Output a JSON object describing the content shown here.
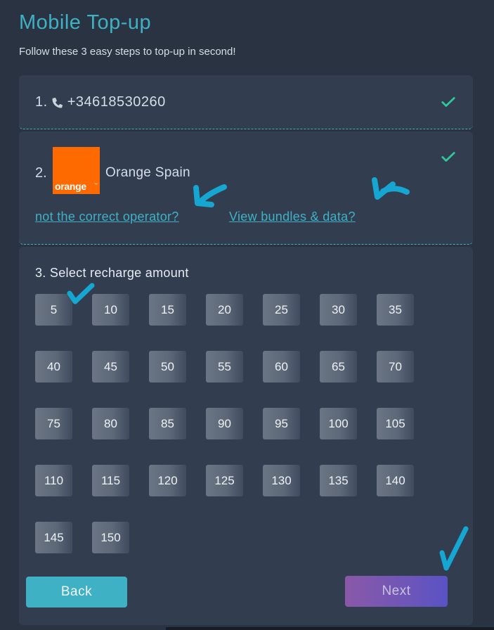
{
  "header": {
    "title": "Mobile Top-up",
    "subtitle": "Follow these 3 easy steps to top-up in second!"
  },
  "step1": {
    "number": "1.",
    "phone_icon": "phone-icon",
    "phone_number": "+34618530260",
    "status_icon": "check-icon"
  },
  "step2": {
    "number": "2.",
    "operator_logo_text": "orange",
    "operator_name": "Orange Spain",
    "status_icon": "check-icon",
    "links": {
      "wrong_operator": "not the correct operator?",
      "bundles": "View bundles & data?"
    }
  },
  "step3": {
    "title": "3. Select recharge amount",
    "amounts": [
      "5",
      "10",
      "15",
      "20",
      "25",
      "30",
      "35",
      "40",
      "45",
      "50",
      "55",
      "60",
      "65",
      "70",
      "75",
      "80",
      "85",
      "90",
      "95",
      "100",
      "105",
      "110",
      "115",
      "120",
      "125",
      "130",
      "135",
      "140",
      "145",
      "150"
    ]
  },
  "actions": {
    "back_label": "Back",
    "next_label": "Next"
  },
  "colors": {
    "accent": "#3fb1c4",
    "success": "#2ec99a",
    "operator_brand": "#ff6a00",
    "annotation": "#16a6d2",
    "next_gradient_start": "#8a58a8",
    "next_gradient_end": "#5a52c4"
  }
}
